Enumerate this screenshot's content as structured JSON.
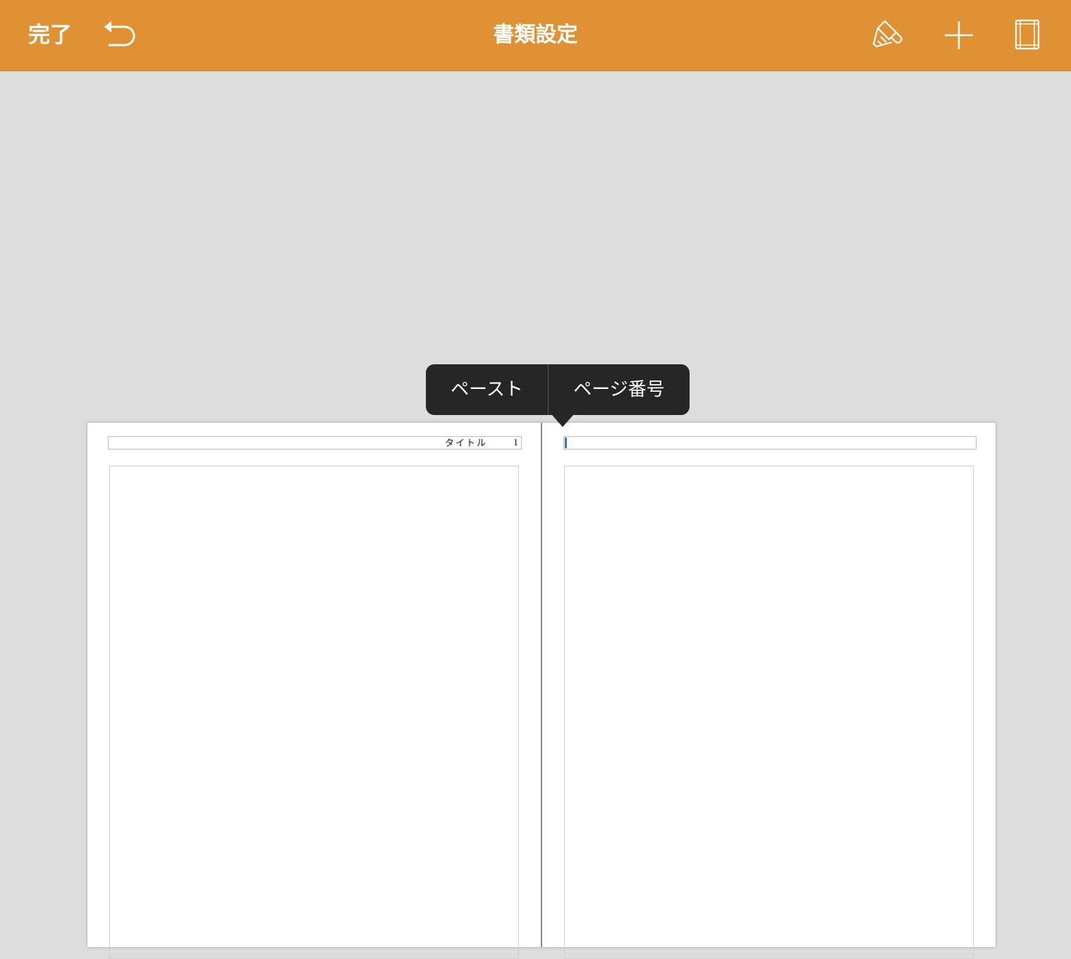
{
  "toolbar": {
    "done_label": "完了",
    "title": "書類設定",
    "undo_icon": "undo-arrow-icon",
    "format_icon": "paintbrush-icon",
    "insert_icon": "plus-icon",
    "document_setup_icon": "document-page-icon",
    "background_color": "#e09134"
  },
  "edit_menu": {
    "items": [
      {
        "label": "ペースト"
      },
      {
        "label": "ページ番号"
      }
    ]
  },
  "document": {
    "left_page": {
      "header_title": "タイトル",
      "header_page_number": "1"
    },
    "right_page": {
      "header_title": "",
      "header_page_number": ""
    },
    "cursor_color": "#2f6fde"
  }
}
